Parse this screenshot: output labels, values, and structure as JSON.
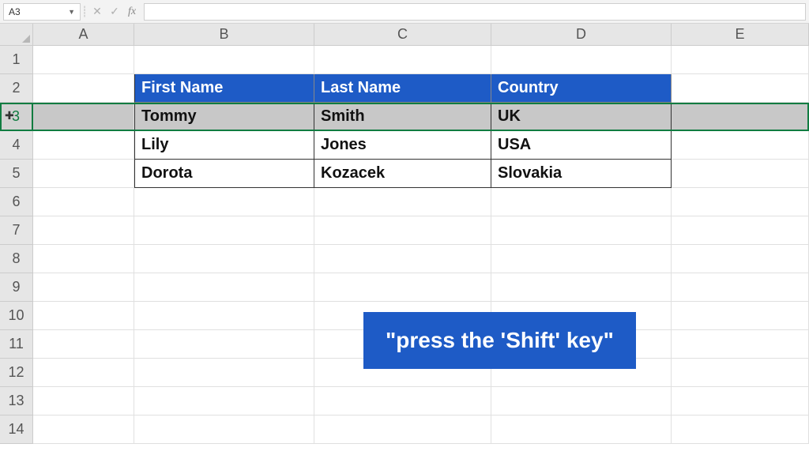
{
  "formula_bar": {
    "name_box": "A3",
    "cancel_icon": "✕",
    "confirm_icon": "✓",
    "fx_label": "fx",
    "formula_value": ""
  },
  "columns": [
    "A",
    "B",
    "C",
    "D",
    "E"
  ],
  "row_numbers": [
    "1",
    "2",
    "3",
    "4",
    "5",
    "6",
    "7",
    "8",
    "9",
    "10",
    "11",
    "12",
    "13",
    "14"
  ],
  "selected_row": "3",
  "table": {
    "headers": [
      "First Name",
      "Last Name",
      "Country"
    ],
    "rows": [
      [
        "Tommy",
        "Smith",
        "UK"
      ],
      [
        "Lily",
        "Jones",
        "USA"
      ],
      [
        "Dorota",
        "Kozacek",
        "Slovakia"
      ]
    ]
  },
  "callout_text": "\"press the 'Shift' key\"",
  "colors": {
    "header_blue": "#1e5bc6",
    "selection_green": "#107c41"
  }
}
